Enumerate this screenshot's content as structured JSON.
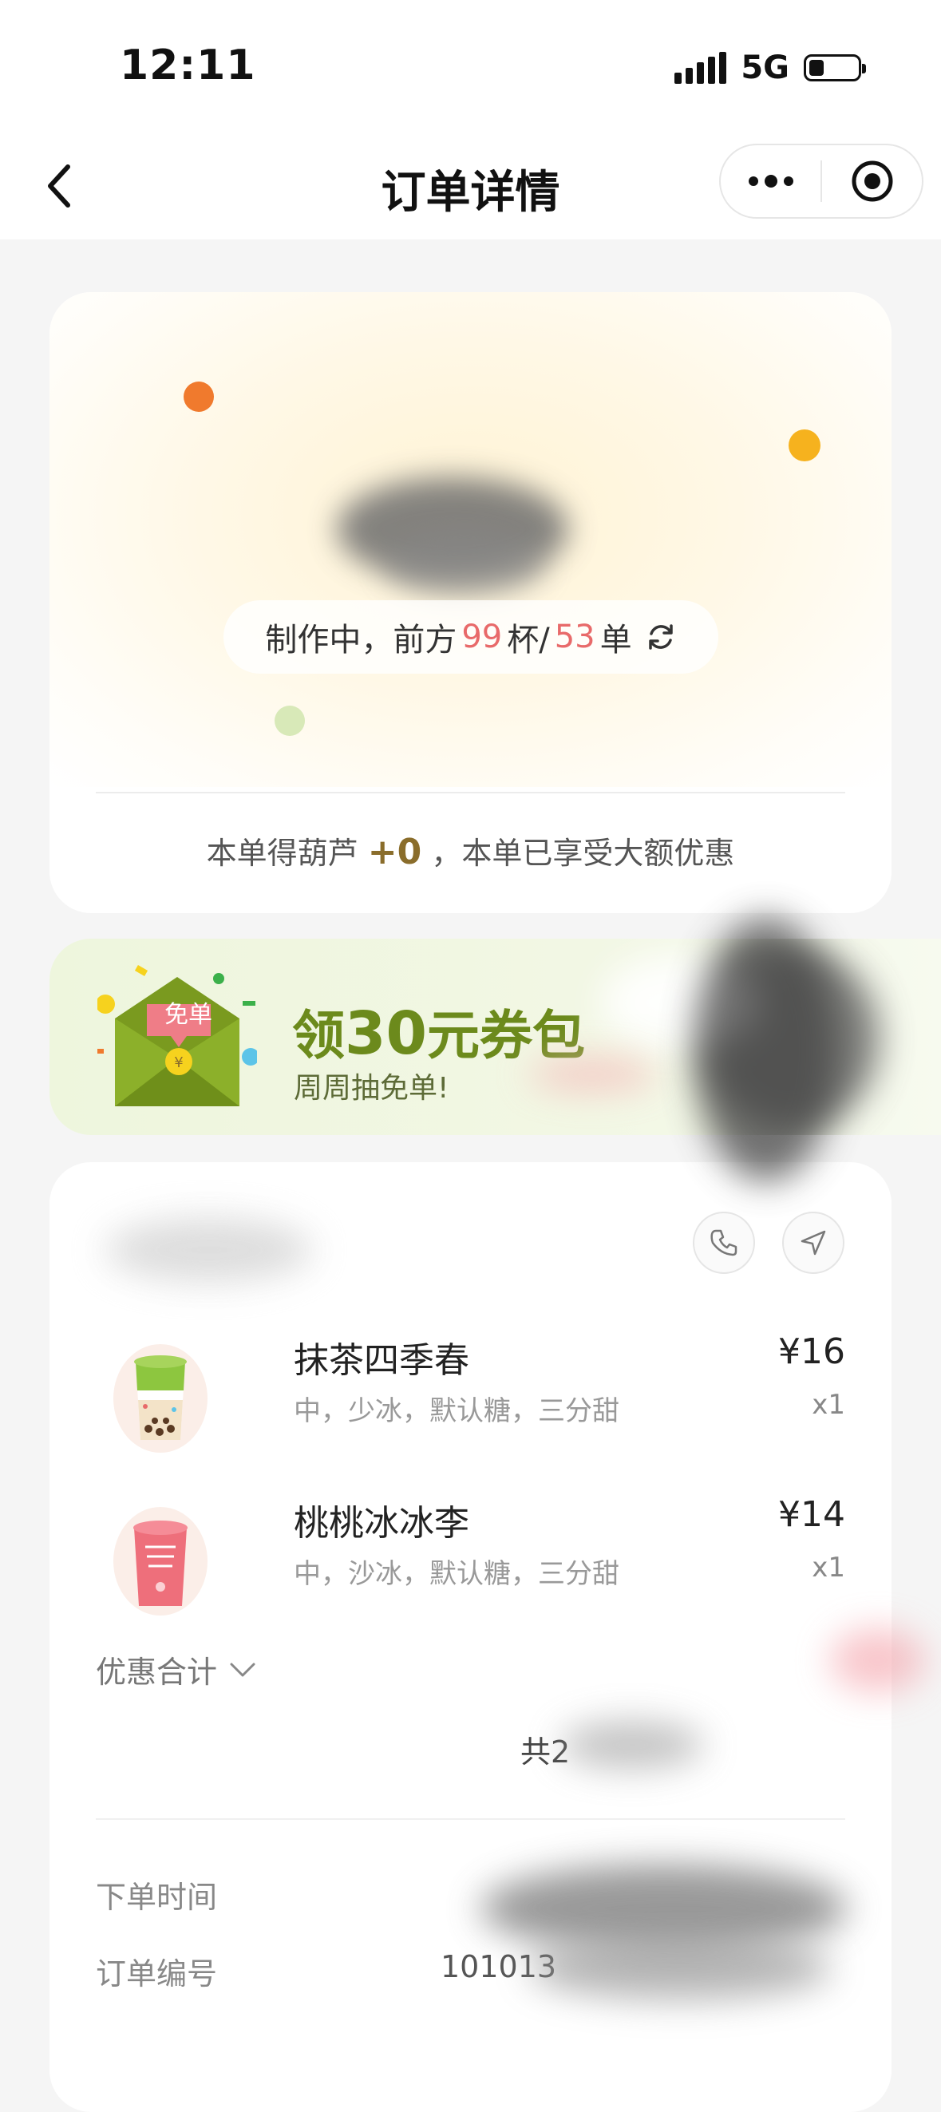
{
  "status_bar": {
    "time": "12:11",
    "network": "5G"
  },
  "nav": {
    "title": "订单详情"
  },
  "progress": {
    "prefix": "制作中，前方",
    "cups": "99",
    "cups_unit": "杯/",
    "orders": "53",
    "orders_unit": "单"
  },
  "points": {
    "prefix": "本单得葫芦",
    "value": "+0",
    "suffix": "，本单已享受大额优惠"
  },
  "promo": {
    "envelope_label": "免单",
    "title_prefix": "领",
    "title_amount": "30",
    "title_suffix": "元券包",
    "subtitle": "周周抽免单!"
  },
  "items": [
    {
      "name": "抹茶四季春",
      "spec": "中，少冰，默认糖，三分甜",
      "price": "¥16",
      "qty": "x1"
    },
    {
      "name": "桃桃冰冰李",
      "spec": "中，沙冰，默认糖，三分甜",
      "price": "¥14",
      "qty": "x1"
    }
  ],
  "discount_label": "优惠合计",
  "total_text": "共2",
  "order_info": {
    "time_label": "下单时间",
    "number_label": "订单编号",
    "number_value": "101013"
  },
  "colors": {
    "accent_red": "#e86a6a",
    "points_brown": "#8a6d2b",
    "promo_green": "#6c8a1c"
  }
}
